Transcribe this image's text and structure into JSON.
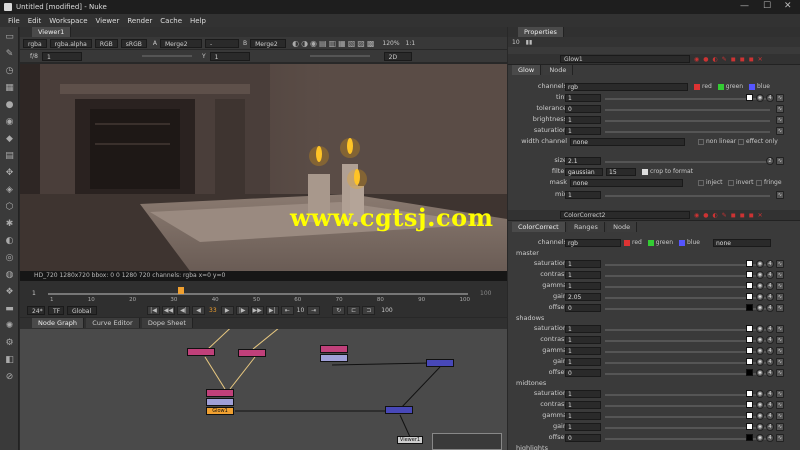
{
  "window": {
    "title": "Untitled [modified] - Nuke",
    "minimize": "—",
    "maximize": "☐",
    "close": "✕"
  },
  "menu": [
    "File",
    "Edit",
    "Workspace",
    "Viewer",
    "Render",
    "Cache",
    "Help"
  ],
  "viewer": {
    "tab": "Viewer1",
    "layer": "rgba",
    "channel": "rgba.alpha",
    "colorspace": "RGB",
    "lut": "sRGB",
    "input_a": "Merge2",
    "input_a_label": "A",
    "input_b": "-",
    "input_b_label": "B",
    "input_b_node": "Merge2",
    "zoom": "120%",
    "ratio": "1:1",
    "fstop_label": "f/8",
    "frame_field": "1",
    "gain_label": "Y",
    "gamma_field": "1",
    "view_mode": "2D",
    "info": "HD_720 1280x720  bbox: 0 0 1280 720 channels: rgba  x=0 y=0",
    "watermark": "www.cgtsj.com"
  },
  "timeline": {
    "start": "1",
    "end": "100",
    "ticks": [
      "1",
      "10",
      "20",
      "30",
      "40",
      "50",
      "60",
      "70",
      "80",
      "90",
      "100"
    ],
    "current_frame": "33",
    "fps": "24*",
    "tf": "TF",
    "range": "Global",
    "step": "10",
    "end_field": "100"
  },
  "nodegraph": {
    "tabs": [
      "Node Graph",
      "Curve Editor",
      "Dope Sheet"
    ],
    "nodes": [
      {
        "label": "Glow1",
        "color": "#f0a030"
      },
      {
        "label": "Viewer1",
        "color": "#cfcfcf"
      }
    ]
  },
  "properties": {
    "tab": "Properties",
    "count": "10",
    "glow": {
      "name": "Glow1",
      "tabs": [
        "Glow",
        "Node"
      ],
      "channels": "rgb",
      "channel_checks": [
        "red",
        "green",
        "blue"
      ],
      "tint": "1",
      "tolerance": "0",
      "brightness": "1",
      "saturation": "1",
      "width_channel_label": "width channel",
      "width_channel": "none",
      "non_linear": "non linear",
      "effect_only": "effect only",
      "size": "2.1",
      "filter_label": "filter",
      "filter": "gaussian",
      "filter_value": "15",
      "crop_to_format": "crop to format",
      "mask_label": "mask",
      "mask": "none",
      "inject": "inject",
      "invert": "invert",
      "fringe": "fringe",
      "mix": "1"
    },
    "cc": {
      "name": "ColorCorrect2",
      "tabs": [
        "ColorCorrect",
        "Ranges",
        "Node"
      ],
      "channels": "rgb",
      "channel_checks": [
        "red",
        "green",
        "blue"
      ],
      "extra": "none",
      "sections": [
        {
          "name": "master",
          "rows": [
            {
              "label": "saturation",
              "value": "1"
            },
            {
              "label": "contrast",
              "value": "1"
            },
            {
              "label": "gamma",
              "value": "1"
            },
            {
              "label": "gain",
              "value": "2.05"
            },
            {
              "label": "offset",
              "value": "0"
            }
          ]
        },
        {
          "name": "shadows",
          "rows": [
            {
              "label": "saturation",
              "value": "1"
            },
            {
              "label": "contrast",
              "value": "1"
            },
            {
              "label": "gamma",
              "value": "1"
            },
            {
              "label": "gain",
              "value": "1"
            },
            {
              "label": "offset",
              "value": "0"
            }
          ]
        },
        {
          "name": "midtones",
          "rows": [
            {
              "label": "saturation",
              "value": "1"
            },
            {
              "label": "contrast",
              "value": "1"
            },
            {
              "label": "gamma",
              "value": "1"
            },
            {
              "label": "gain",
              "value": "1"
            },
            {
              "label": "offset",
              "value": "0"
            }
          ]
        },
        {
          "name": "highlights",
          "rows": []
        }
      ]
    },
    "labels": {
      "channels": "channels",
      "tint": "tint",
      "tolerance": "tolerance",
      "brightness": "brightness",
      "saturation": "saturation",
      "size": "size",
      "mix": "mix"
    }
  },
  "colors": {
    "accent_yellow": "#ffff00",
    "node_pink": "#c0407a",
    "node_blue": "#4848b8",
    "glow_node": "#f0a030"
  }
}
